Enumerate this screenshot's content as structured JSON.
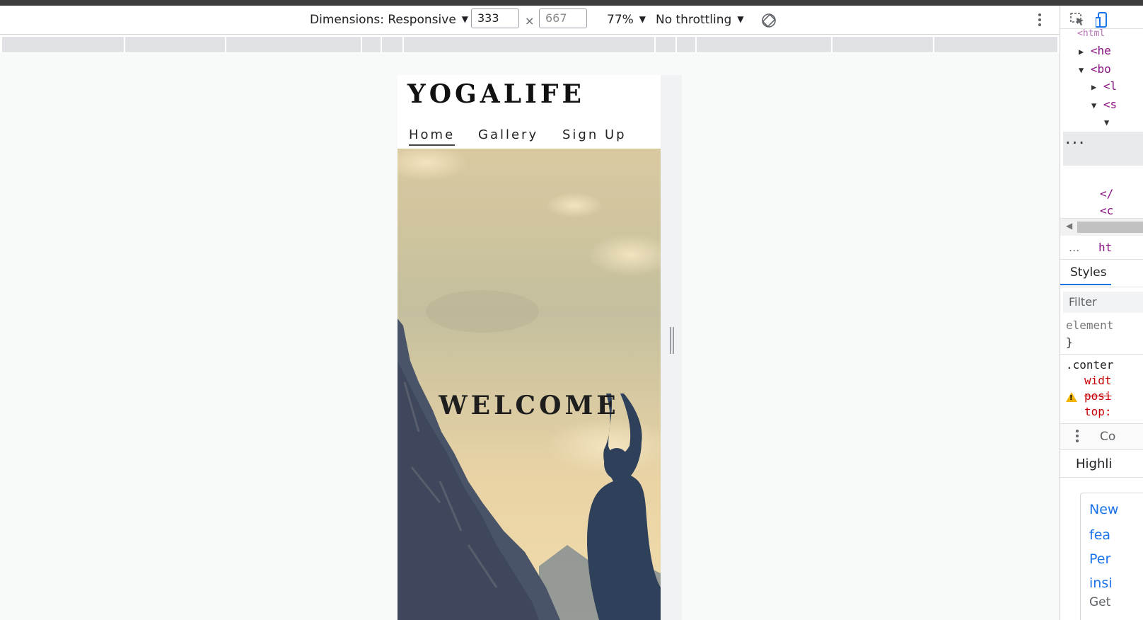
{
  "toolbar": {
    "dimensions_label": "Dimensions: Responsive",
    "width_value": "333",
    "height_placeholder": "667",
    "times_symbol": "×",
    "zoom_label": "77%",
    "throttling_label": "No throttling",
    "caret": "▼"
  },
  "site": {
    "title": "YOGALIFE",
    "nav": [
      {
        "label": "Home",
        "active": true
      },
      {
        "label": "Gallery",
        "active": false
      },
      {
        "label": "Sign Up",
        "active": false
      }
    ],
    "hero_text": "WELCOME"
  },
  "devtools": {
    "elements": {
      "line_head": "<he",
      "line_body": "<bo",
      "line_child1": "<l",
      "line_child2": "<s",
      "line_close1": "</",
      "line_close2": "<c",
      "ellipsis": "...",
      "breadcrumb_ellipsis": "...",
      "breadcrumb_html": "ht"
    },
    "styles": {
      "tab_label": "Styles",
      "filter_placeholder": "Filter",
      "rule1_selector": "element",
      "rule1_close": "}",
      "rule2_selector": ".conter",
      "prop_width": "widt",
      "prop_position": "posi",
      "prop_top": "top:"
    },
    "drawer": {
      "tab_partial": "Co",
      "highlights_partial": "Highli",
      "links": [
        "New",
        "fea",
        "Per",
        "insi"
      ],
      "footer_partial": "Get"
    }
  },
  "colors": {
    "tag": "#881280",
    "link": "#1a73e8",
    "accent": "#1a73e8"
  }
}
